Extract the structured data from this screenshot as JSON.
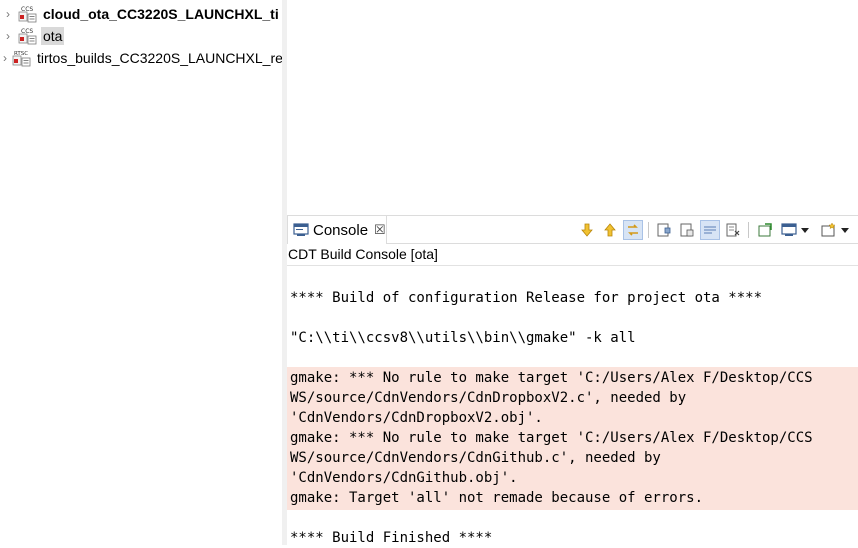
{
  "explorer": {
    "projects": [
      {
        "name": "cloud_ota_CC3220S_LAUNCHXL_ti",
        "icon_badge": "CCS",
        "bold": true,
        "selected": false
      },
      {
        "name": "ota",
        "icon_badge": "CCS",
        "bold": false,
        "selected": true
      },
      {
        "name": "tirtos_builds_CC3220S_LAUNCHXL_re",
        "icon_badge": "RTSC",
        "bold": false,
        "selected": false
      }
    ]
  },
  "console": {
    "tab_label": "Console",
    "tab_close": "☒",
    "subtitle": "CDT Build Console [ota]",
    "lines": [
      "**** Build of configuration Release for project ota ****",
      "",
      "\"C:\\\\ti\\\\ccsv8\\\\utils\\\\bin\\\\gmake\" -k all",
      "",
      "gmake: *** No rule to make target 'C:/Users/Alex F/Desktop/CCS",
      "WS/source/CdnVendors/CdnDropboxV2.c', needed by",
      "'CdnVendors/CdnDropboxV2.obj'.",
      "gmake: *** No rule to make target 'C:/Users/Alex F/Desktop/CCS",
      "WS/source/CdnVendors/CdnGithub.c', needed by",
      "'CdnVendors/CdnGithub.obj'.",
      "gmake: Target 'all' not remade because of errors.",
      "",
      "**** Build Finished ****"
    ],
    "error_highlight_color": "#fbe3dc"
  }
}
